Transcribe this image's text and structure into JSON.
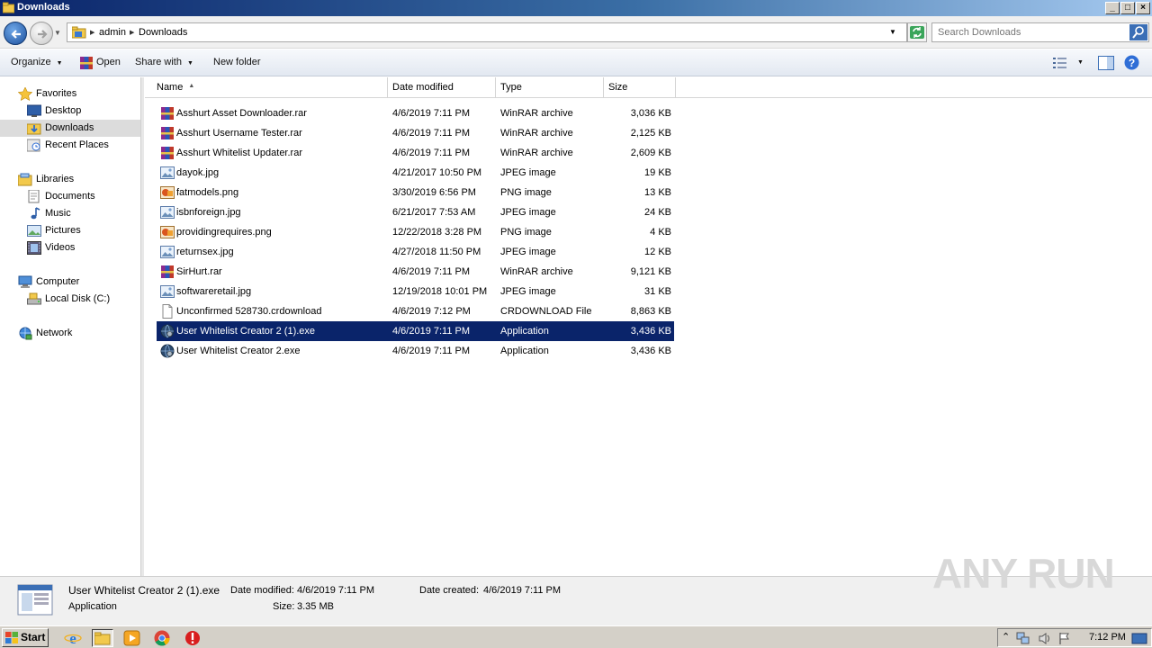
{
  "window": {
    "title": "Downloads",
    "controls": [
      "_",
      "□",
      "×"
    ]
  },
  "address": {
    "crumbs": [
      "admin",
      "Downloads"
    ],
    "search_placeholder": "Search Downloads"
  },
  "toolbar": {
    "organize": "Organize",
    "open": "Open",
    "share_with": "Share with",
    "new_folder": "New folder"
  },
  "nav": {
    "favorites": "Favorites",
    "desktop": "Desktop",
    "downloads": "Downloads",
    "recent": "Recent Places",
    "libraries": "Libraries",
    "documents": "Documents",
    "music": "Music",
    "pictures": "Pictures",
    "videos": "Videos",
    "computer": "Computer",
    "local_disk": "Local Disk (C:)",
    "network": "Network"
  },
  "columns": {
    "name": "Name",
    "date": "Date modified",
    "type": "Type",
    "size": "Size"
  },
  "files": [
    {
      "name": "Asshurt Asset Downloader.rar",
      "date": "4/6/2019 7:11 PM",
      "type": "WinRAR archive",
      "size": "3,036 KB",
      "icon": "winrar-icon"
    },
    {
      "name": "Asshurt Username Tester.rar",
      "date": "4/6/2019 7:11 PM",
      "type": "WinRAR archive",
      "size": "2,125 KB",
      "icon": "winrar-icon"
    },
    {
      "name": "Asshurt Whitelist Updater.rar",
      "date": "4/6/2019 7:11 PM",
      "type": "WinRAR archive",
      "size": "2,609 KB",
      "icon": "winrar-icon"
    },
    {
      "name": "dayok.jpg",
      "date": "4/21/2017 10:50 PM",
      "type": "JPEG image",
      "size": "19 KB",
      "icon": "jpeg-icon"
    },
    {
      "name": "fatmodels.png",
      "date": "3/30/2019 6:56 PM",
      "type": "PNG image",
      "size": "13 KB",
      "icon": "png-icon"
    },
    {
      "name": "isbnforeign.jpg",
      "date": "6/21/2017 7:53 AM",
      "type": "JPEG image",
      "size": "24 KB",
      "icon": "jpeg-icon"
    },
    {
      "name": "providingrequires.png",
      "date": "12/22/2018 3:28 PM",
      "type": "PNG image",
      "size": "4 KB",
      "icon": "png-icon"
    },
    {
      "name": "returnsex.jpg",
      "date": "4/27/2018 11:50 PM",
      "type": "JPEG image",
      "size": "12 KB",
      "icon": "jpeg-icon"
    },
    {
      "name": "SirHurt.rar",
      "date": "4/6/2019 7:11 PM",
      "type": "WinRAR archive",
      "size": "9,121 KB",
      "icon": "winrar-icon"
    },
    {
      "name": "softwareretail.jpg",
      "date": "12/19/2018 10:01 PM",
      "type": "JPEG image",
      "size": "31 KB",
      "icon": "jpeg-icon"
    },
    {
      "name": "Unconfirmed 528730.crdownload",
      "date": "4/6/2019 7:12 PM",
      "type": "CRDOWNLOAD File",
      "size": "8,863 KB",
      "icon": "blank-file-icon"
    },
    {
      "name": "User Whitelist Creator 2 (1).exe",
      "date": "4/6/2019 7:11 PM",
      "type": "Application",
      "size": "3,436 KB",
      "icon": "exe-globe-icon",
      "selected": true
    },
    {
      "name": "User Whitelist Creator 2.exe",
      "date": "4/6/2019 7:11 PM",
      "type": "Application",
      "size": "3,436 KB",
      "icon": "exe-globe-icon"
    }
  ],
  "details": {
    "name": "User Whitelist Creator 2 (1).exe",
    "type": "Application",
    "modified_label": "Date modified:",
    "modified": "4/6/2019 7:11 PM",
    "size_label": "Size:",
    "size": "3.35 MB",
    "created_label": "Date created:",
    "created": "4/6/2019 7:11 PM"
  },
  "watermark": "ANY RUN",
  "taskbar": {
    "start": "Start",
    "clock": "7:12 PM"
  },
  "colors": {
    "selection": "#0a246a",
    "titlebar_start": "#0a246a",
    "titlebar_end": "#a6caf0"
  }
}
